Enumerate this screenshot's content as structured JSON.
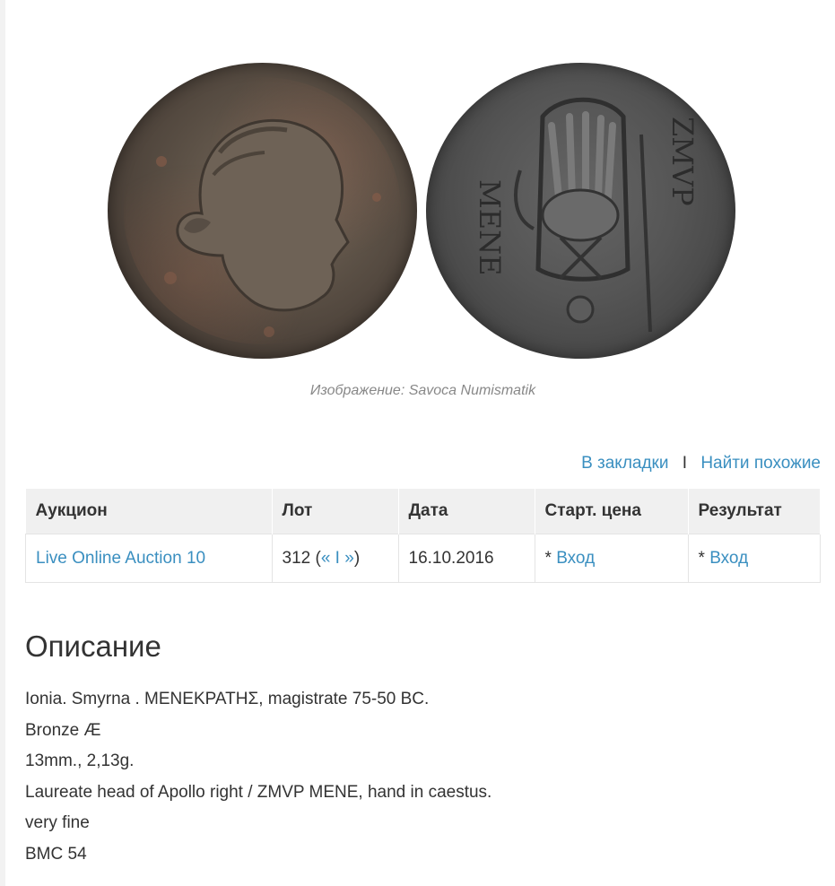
{
  "image": {
    "caption": "Изображение: Savoca Numismatik",
    "obverse_alt": "Obverse: laureate head of Apollo right",
    "reverse_alt": "Reverse: hand in caestus, ZMVP MENE"
  },
  "actions": {
    "bookmark": "В закладки",
    "separator": "I",
    "find_similar": "Найти похожие"
  },
  "table": {
    "headers": [
      "Аукцион",
      "Лот",
      "Дата",
      "Старт. цена",
      "Результат"
    ],
    "row": {
      "auction": "Live Online Auction 10",
      "lot_number": "312",
      "lot_open": "(",
      "lot_prev": "«",
      "lot_sep": " I ",
      "lot_next": "»",
      "lot_close": ")",
      "date": "16.10.2016",
      "start_price_prefix": "* ",
      "start_price_link": "Вход",
      "result_prefix": "* ",
      "result_link": "Вход"
    }
  },
  "description": {
    "title": "Описание",
    "lines": [
      "Ionia. Smyrna . MENEKPATHΣ, magistrate 75-50 BC.",
      "Bronze Æ",
      "13mm., 2,13g.",
      "Laureate head of Apollo right / ZMVP MENE, hand in caestus.",
      "very fine",
      "BMC 54"
    ]
  }
}
